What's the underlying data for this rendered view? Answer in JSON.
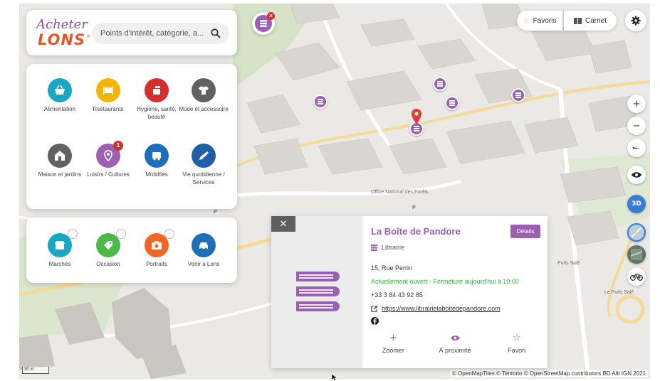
{
  "brand": {
    "logo_line1": "Acheter",
    "logo_line2": "LONS",
    "logo_reg": "®",
    "accent_purple": "#9b5fb3",
    "accent_orange": "#e0582a"
  },
  "search": {
    "placeholder": "Points d'intérêt, catégorie, a...",
    "icon": "search-icon"
  },
  "categories": [
    {
      "label": "Alimentation",
      "color": "#1aa7c1",
      "icon": "basket-icon"
    },
    {
      "label": "Restaurants",
      "color": "#f4b400",
      "icon": "cutlery-icon"
    },
    {
      "label": "Hygiène, santé, beauté",
      "color": "#d32f2f",
      "icon": "hygiene-icon"
    },
    {
      "label": "Mode et accessoire",
      "color": "#616161",
      "icon": "shirt-icon"
    },
    {
      "label": "Maison et jardins",
      "color": "#616161",
      "icon": "house-icon"
    },
    {
      "label": "Loisirs / Cultures",
      "color": "#9b5fb3",
      "icon": "leisure-icon",
      "badge": "1"
    },
    {
      "label": "Mobilités",
      "color": "#1e6fb8",
      "icon": "bus-icon"
    },
    {
      "label": "Vie quotidienne / Services",
      "color": "#1e5fa8",
      "icon": "pen-icon"
    }
  ],
  "extras": [
    {
      "label": "Marchés",
      "color": "#1aa7c1",
      "icon": "market-icon"
    },
    {
      "label": "Occasion",
      "color": "#4cb848",
      "icon": "occasion-icon"
    },
    {
      "label": "Portraits",
      "color": "#f26522",
      "icon": "camera-icon"
    },
    {
      "label": "Venir à Lons",
      "color": "#1e6fb8",
      "icon": "car-icon"
    }
  ],
  "toolbar": {
    "favoris_label": "Favoris",
    "carnet_label": "Carnet"
  },
  "map_controls": {
    "zoom_in": "+",
    "zoom_out": "−",
    "mode_3d": "3D"
  },
  "map": {
    "labels": [
      "Office National des Forêts",
      "Puits Salé",
      "Le Puits Salé",
      "P",
      "P",
      "P"
    ],
    "scale": "30 m",
    "attribution": "© OpenMapTiles © Tentorio © OpenStreetMap contributors BD Alti IGN 2021"
  },
  "place": {
    "title": "La Boîte de Pandore",
    "details_label": "Détails",
    "category": "Librairie",
    "address": "15, Rue Perrin",
    "status": "Actuellement ouvert - Fermeture aujourd'hui à 19:00",
    "phone": "+33 3 84 43 92 85",
    "website": "https://www.librairielaboitedepandore.com"
  },
  "actions": [
    {
      "label": "Zoomer",
      "icon": "plus-icon"
    },
    {
      "label": "À proximité",
      "icon": "eye-icon"
    },
    {
      "label": "Favori",
      "icon": "star-icon"
    }
  ]
}
